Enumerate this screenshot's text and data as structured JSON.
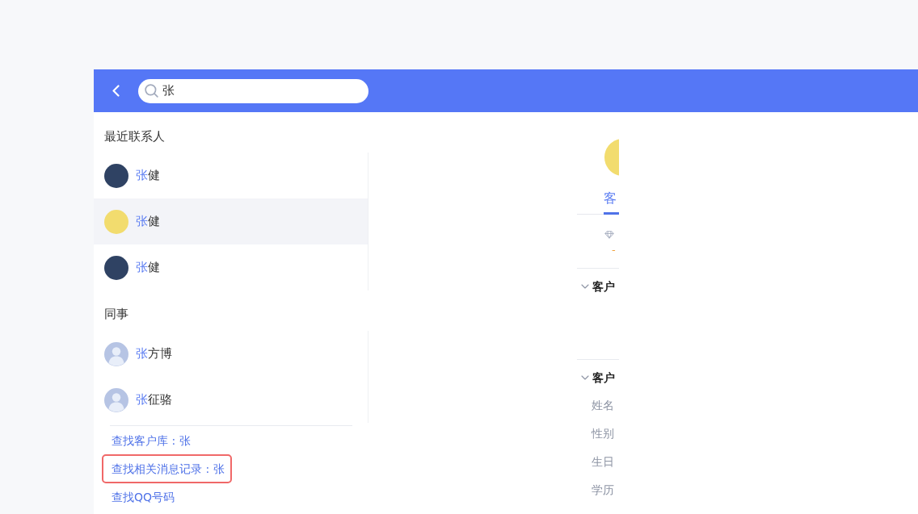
{
  "header": {
    "search": {
      "value": "张"
    }
  },
  "sections": [
    {
      "title": "最近联系人",
      "contacts": [
        {
          "match": "张",
          "rest": "健",
          "selected": false,
          "avatar": {
            "kind": "photo",
            "color": "#2f4263"
          }
        },
        {
          "match": "张",
          "rest": "健",
          "selected": true,
          "avatar": {
            "kind": "photo",
            "color": "#f2dc6e"
          }
        },
        {
          "match": "张",
          "rest": "健",
          "selected": false,
          "avatar": {
            "kind": "photo",
            "color": "#2f4263"
          }
        }
      ]
    },
    {
      "title": "同事",
      "contacts": [
        {
          "match": "张",
          "rest": "方博",
          "selected": false,
          "avatar": {
            "kind": "silhouette"
          }
        },
        {
          "match": "张",
          "rest": "征骆",
          "selected": false,
          "avatar": {
            "kind": "silhouette"
          }
        }
      ]
    }
  ],
  "search_links": [
    {
      "label": "查找客户库 : 张",
      "outlined": false
    },
    {
      "label": "查找相关消息记录 : 张",
      "outlined": true
    },
    {
      "label": "查找QQ号码",
      "outlined": false
    }
  ],
  "detail": {
    "avatar": {
      "kind": "photo",
      "color": "#f2dc6e"
    },
    "tabs": [
      {
        "label": "客",
        "selected": true
      }
    ],
    "stat": {
      "value": "-"
    },
    "sections": [
      {
        "title": "客户",
        "expanded": true
      },
      {
        "title": "客户",
        "expanded": true,
        "fields": [
          {
            "label": "姓名"
          },
          {
            "label": "性别"
          },
          {
            "label": "生日"
          },
          {
            "label": "学历"
          }
        ]
      }
    ]
  }
}
